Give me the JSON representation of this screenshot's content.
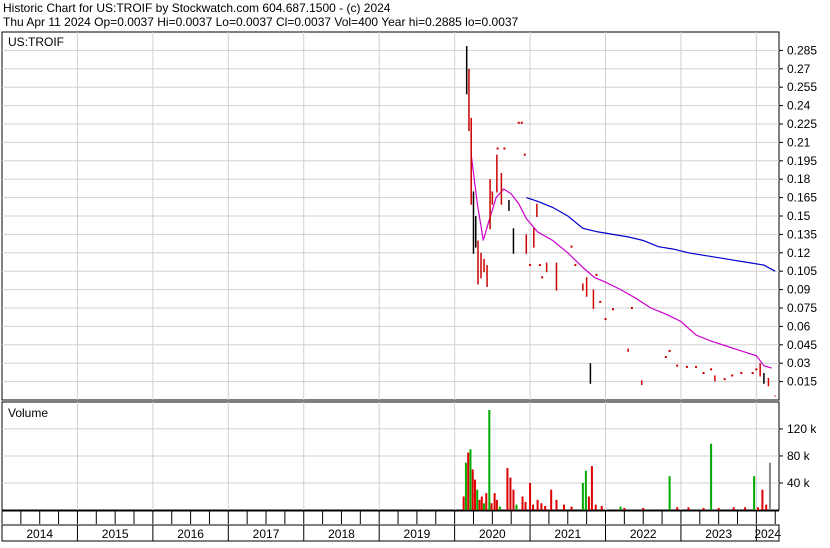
{
  "header": {
    "title": "Historic Chart for US:TROIF by Stockwatch.com 604.687.1500 - (c) 2024",
    "quote": "Thu Apr 11 2024   Op=0.0037   Hi=0.0037   Lo=0.0037   Cl=0.0037   Vol=400   Year hi=0.2885   lo=0.0037"
  },
  "colors": {
    "price_up": "#000000",
    "price_down": "#cc0000",
    "ma_short": "#cc00cc",
    "ma_long": "#0000cc",
    "vol_up": "#00aa00",
    "vol_down": "#dd0000",
    "vol_flat": "#888888",
    "grid": "#d0d0d0"
  },
  "chart_data": [
    {
      "type": "line",
      "name": "price-panel",
      "label": "US:TROIF",
      "ylim": [
        0,
        0.3
      ],
      "xlim": [
        2014.0,
        2024.3
      ],
      "y_ticks": [
        0.015,
        0.03,
        0.045,
        0.06,
        0.075,
        0.09,
        0.105,
        0.12,
        0.135,
        0.15,
        0.165,
        0.18,
        0.195,
        0.21,
        0.225,
        0.24,
        0.255,
        0.27,
        0.285
      ],
      "grid": true,
      "price_bars": [
        {
          "x": 2020.16,
          "low": 0.25,
          "high": 0.2885,
          "up": true
        },
        {
          "x": 2020.19,
          "low": 0.22,
          "high": 0.27,
          "up": false
        },
        {
          "x": 2020.22,
          "low": 0.16,
          "high": 0.23,
          "up": false
        },
        {
          "x": 2020.25,
          "low": 0.12,
          "high": 0.17,
          "up": true
        },
        {
          "x": 2020.28,
          "low": 0.125,
          "high": 0.15,
          "up": true
        },
        {
          "x": 2020.31,
          "low": 0.095,
          "high": 0.13,
          "up": false
        },
        {
          "x": 2020.35,
          "low": 0.1,
          "high": 0.12,
          "up": false
        },
        {
          "x": 2020.39,
          "low": 0.105,
          "high": 0.115,
          "up": false
        },
        {
          "x": 2020.43,
          "low": 0.093,
          "high": 0.11,
          "up": false
        },
        {
          "x": 2020.47,
          "low": 0.14,
          "high": 0.18,
          "up": false
        },
        {
          "x": 2020.5,
          "low": 0.16,
          "high": 0.17,
          "up": false
        },
        {
          "x": 2020.56,
          "low": 0.17,
          "high": 0.2,
          "up": false
        },
        {
          "x": 2020.62,
          "low": 0.16,
          "high": 0.185,
          "up": false
        },
        {
          "x": 2020.72,
          "low": 0.155,
          "high": 0.163,
          "up": true
        },
        {
          "x": 2020.78,
          "low": 0.12,
          "high": 0.14,
          "up": true
        },
        {
          "x": 2020.95,
          "low": 0.12,
          "high": 0.135,
          "up": false
        },
        {
          "x": 2021.05,
          "low": 0.125,
          "high": 0.14,
          "up": false
        },
        {
          "x": 2021.09,
          "low": 0.15,
          "high": 0.16,
          "up": false
        },
        {
          "x": 2021.22,
          "low": 0.105,
          "high": 0.112,
          "up": false
        },
        {
          "x": 2021.35,
          "low": 0.09,
          "high": 0.112,
          "up": false
        },
        {
          "x": 2021.7,
          "low": 0.09,
          "high": 0.095,
          "up": false
        },
        {
          "x": 2021.75,
          "low": 0.085,
          "high": 0.1,
          "up": false
        },
        {
          "x": 2021.8,
          "low": 0.014,
          "high": 0.03,
          "up": true
        },
        {
          "x": 2021.84,
          "low": 0.075,
          "high": 0.09,
          "up": false
        },
        {
          "x": 2022.3,
          "low": 0.04,
          "high": 0.042,
          "up": false
        },
        {
          "x": 2022.48,
          "low": 0.013,
          "high": 0.016,
          "up": false
        },
        {
          "x": 2023.45,
          "low": 0.016,
          "high": 0.02,
          "up": false
        },
        {
          "x": 2024.05,
          "low": 0.02,
          "high": 0.03,
          "up": false
        },
        {
          "x": 2024.1,
          "low": 0.014,
          "high": 0.022,
          "up": true
        },
        {
          "x": 2024.16,
          "low": 0.012,
          "high": 0.018,
          "up": false
        },
        {
          "x": 2024.25,
          "low": 0.0037,
          "high": 0.0037,
          "up": false
        }
      ],
      "price_dots": [
        {
          "x": 2020.57,
          "y": 0.205
        },
        {
          "x": 2020.66,
          "y": 0.205
        },
        {
          "x": 2020.85,
          "y": 0.226
        },
        {
          "x": 2020.89,
          "y": 0.226
        },
        {
          "x": 2020.93,
          "y": 0.2
        },
        {
          "x": 2021.0,
          "y": 0.11
        },
        {
          "x": 2021.13,
          "y": 0.11
        },
        {
          "x": 2021.16,
          "y": 0.1
        },
        {
          "x": 2021.55,
          "y": 0.125
        },
        {
          "x": 2021.6,
          "y": 0.11
        },
        {
          "x": 2021.88,
          "y": 0.102
        },
        {
          "x": 2021.93,
          "y": 0.08
        },
        {
          "x": 2022.0,
          "y": 0.066
        },
        {
          "x": 2022.1,
          "y": 0.074
        },
        {
          "x": 2022.35,
          "y": 0.075
        },
        {
          "x": 2022.8,
          "y": 0.035
        },
        {
          "x": 2022.85,
          "y": 0.04
        },
        {
          "x": 2022.95,
          "y": 0.028
        },
        {
          "x": 2023.08,
          "y": 0.027
        },
        {
          "x": 2023.2,
          "y": 0.027
        },
        {
          "x": 2023.3,
          "y": 0.022
        },
        {
          "x": 2023.4,
          "y": 0.025
        },
        {
          "x": 2023.58,
          "y": 0.017
        },
        {
          "x": 2023.68,
          "y": 0.02
        },
        {
          "x": 2023.8,
          "y": 0.022
        },
        {
          "x": 2023.95,
          "y": 0.022
        },
        {
          "x": 2024.0,
          "y": 0.025
        }
      ],
      "series": [
        {
          "color_key": "ma_short",
          "x": [
            2020.22,
            2020.3,
            2020.38,
            2020.45,
            2020.55,
            2020.65,
            2020.75,
            2020.85,
            2020.95,
            2021.1,
            2021.3,
            2021.5,
            2021.7,
            2021.85,
            2022.0,
            2022.2,
            2022.4,
            2022.6,
            2022.8,
            2023.0,
            2023.2,
            2023.4,
            2023.6,
            2023.8,
            2024.0,
            2024.1,
            2024.2
          ],
          "y": [
            0.2,
            0.16,
            0.13,
            0.145,
            0.165,
            0.172,
            0.168,
            0.16,
            0.148,
            0.137,
            0.13,
            0.12,
            0.108,
            0.1,
            0.096,
            0.09,
            0.083,
            0.075,
            0.07,
            0.064,
            0.053,
            0.048,
            0.044,
            0.04,
            0.036,
            0.028,
            0.026
          ]
        },
        {
          "color_key": "ma_long",
          "x": [
            2020.95,
            2021.1,
            2021.3,
            2021.5,
            2021.7,
            2021.9,
            2022.1,
            2022.3,
            2022.5,
            2022.7,
            2022.9,
            2023.1,
            2023.3,
            2023.5,
            2023.7,
            2023.9,
            2024.1,
            2024.25
          ],
          "y": [
            0.165,
            0.162,
            0.157,
            0.15,
            0.14,
            0.137,
            0.135,
            0.133,
            0.13,
            0.125,
            0.123,
            0.12,
            0.118,
            0.116,
            0.114,
            0.112,
            0.11,
            0.105
          ]
        }
      ]
    },
    {
      "type": "bar",
      "name": "volume-panel",
      "label": "Volume",
      "ylim": [
        0,
        148000
      ],
      "y_ticks": [
        40000,
        80000,
        120000
      ],
      "y_tick_labels": [
        "40 k",
        "80 k",
        "120 k"
      ],
      "bars": [
        {
          "x": 2020.12,
          "v": 20000,
          "c": "vol_down"
        },
        {
          "x": 2020.15,
          "v": 70000,
          "c": "vol_up"
        },
        {
          "x": 2020.18,
          "v": 85000,
          "c": "vol_down"
        },
        {
          "x": 2020.21,
          "v": 90000,
          "c": "vol_up"
        },
        {
          "x": 2020.24,
          "v": 60000,
          "c": "vol_down"
        },
        {
          "x": 2020.27,
          "v": 45000,
          "c": "vol_down"
        },
        {
          "x": 2020.3,
          "v": 30000,
          "c": "vol_up"
        },
        {
          "x": 2020.33,
          "v": 15000,
          "c": "vol_down"
        },
        {
          "x": 2020.36,
          "v": 20000,
          "c": "vol_down"
        },
        {
          "x": 2020.39,
          "v": 10000,
          "c": "vol_up"
        },
        {
          "x": 2020.42,
          "v": 25000,
          "c": "vol_down"
        },
        {
          "x": 2020.46,
          "v": 148000,
          "c": "vol_up"
        },
        {
          "x": 2020.49,
          "v": 10000,
          "c": "vol_down"
        },
        {
          "x": 2020.53,
          "v": 25000,
          "c": "vol_down"
        },
        {
          "x": 2020.56,
          "v": 15000,
          "c": "vol_down"
        },
        {
          "x": 2020.6,
          "v": 5000,
          "c": "vol_up"
        },
        {
          "x": 2020.7,
          "v": 62000,
          "c": "vol_down"
        },
        {
          "x": 2020.74,
          "v": 48000,
          "c": "vol_down"
        },
        {
          "x": 2020.78,
          "v": 30000,
          "c": "vol_down"
        },
        {
          "x": 2020.82,
          "v": 8000,
          "c": "vol_up"
        },
        {
          "x": 2020.9,
          "v": 20000,
          "c": "vol_down"
        },
        {
          "x": 2020.94,
          "v": 12000,
          "c": "vol_down"
        },
        {
          "x": 2021.0,
          "v": 40000,
          "c": "vol_down"
        },
        {
          "x": 2021.04,
          "v": 8000,
          "c": "vol_down"
        },
        {
          "x": 2021.1,
          "v": 15000,
          "c": "vol_down"
        },
        {
          "x": 2021.15,
          "v": 10000,
          "c": "vol_down"
        },
        {
          "x": 2021.2,
          "v": 6000,
          "c": "vol_down"
        },
        {
          "x": 2021.28,
          "v": 30000,
          "c": "vol_down"
        },
        {
          "x": 2021.35,
          "v": 15000,
          "c": "vol_down"
        },
        {
          "x": 2021.45,
          "v": 8000,
          "c": "vol_down"
        },
        {
          "x": 2021.55,
          "v": 5000,
          "c": "vol_down"
        },
        {
          "x": 2021.7,
          "v": 40000,
          "c": "vol_up"
        },
        {
          "x": 2021.74,
          "v": 58000,
          "c": "vol_up"
        },
        {
          "x": 2021.78,
          "v": 20000,
          "c": "vol_down"
        },
        {
          "x": 2021.82,
          "v": 65000,
          "c": "vol_down"
        },
        {
          "x": 2021.87,
          "v": 8000,
          "c": "vol_down"
        },
        {
          "x": 2021.95,
          "v": 6000,
          "c": "vol_down"
        },
        {
          "x": 2022.2,
          "v": 5000,
          "c": "vol_up"
        },
        {
          "x": 2022.25,
          "v": 3000,
          "c": "vol_down"
        },
        {
          "x": 2022.5,
          "v": 3000,
          "c": "vol_down"
        },
        {
          "x": 2022.85,
          "v": 50000,
          "c": "vol_up"
        },
        {
          "x": 2022.95,
          "v": 4000,
          "c": "vol_down"
        },
        {
          "x": 2023.1,
          "v": 4000,
          "c": "vol_down"
        },
        {
          "x": 2023.3,
          "v": 3000,
          "c": "vol_down"
        },
        {
          "x": 2023.4,
          "v": 98000,
          "c": "vol_up"
        },
        {
          "x": 2023.5,
          "v": 3000,
          "c": "vol_down"
        },
        {
          "x": 2023.7,
          "v": 4000,
          "c": "vol_down"
        },
        {
          "x": 2023.85,
          "v": 4000,
          "c": "vol_down"
        },
        {
          "x": 2023.97,
          "v": 50000,
          "c": "vol_up"
        },
        {
          "x": 2024.02,
          "v": 4000,
          "c": "vol_down"
        },
        {
          "x": 2024.08,
          "v": 30000,
          "c": "vol_down"
        },
        {
          "x": 2024.13,
          "v": 8000,
          "c": "vol_down"
        },
        {
          "x": 2024.18,
          "v": 70000,
          "c": "vol_flat"
        },
        {
          "x": 2024.25,
          "v": 400,
          "c": "vol_down"
        }
      ]
    }
  ],
  "x_axis": {
    "years": [
      "2014",
      "2015",
      "2016",
      "2017",
      "2018",
      "2019",
      "2020",
      "2021",
      "2022",
      "2023",
      "2024"
    ]
  }
}
